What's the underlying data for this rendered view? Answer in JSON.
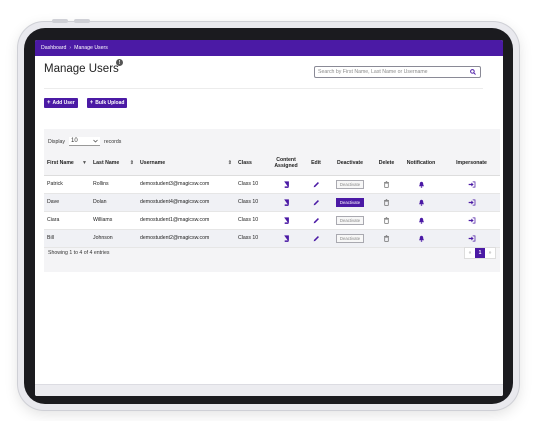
{
  "breadcrumb": {
    "home": "Dashboard",
    "separator": "›",
    "current": "Manage Users"
  },
  "page": {
    "title": "Manage Users",
    "info_badge": "!"
  },
  "search": {
    "placeholder": "Search by First Name, Last Name or Username",
    "value": ""
  },
  "actions": {
    "add_user": "Add User",
    "bulk_upload": "Bulk Upload"
  },
  "table_controls": {
    "display_label": "Display",
    "page_size": "10",
    "records_label": "records"
  },
  "columns": [
    "First Name",
    "Last Name",
    "Username",
    "Class",
    "Content Assigned",
    "Edit",
    "Deactivate",
    "Delete",
    "Notification",
    "Impersonate"
  ],
  "rows": [
    {
      "first": "Patrick",
      "last": "Rollins",
      "username": "demostudent3@magicsw.com",
      "class": "Class 10",
      "deactivate": "Deactivate",
      "deactivate_active": false
    },
    {
      "first": "Dave",
      "last": "Dolan",
      "username": "demostudent4@magicsw.com",
      "class": "Class 10",
      "deactivate": "Deactivate",
      "deactivate_active": true
    },
    {
      "first": "Ciara",
      "last": "Williams",
      "username": "demostudent1@magicsw.com",
      "class": "Class 10",
      "deactivate": "Deactivate",
      "deactivate_active": false
    },
    {
      "first": "Bill",
      "last": "Johnson",
      "username": "demostudent2@magicsw.com",
      "class": "Class 10",
      "deactivate": "Deactivate",
      "deactivate_active": false
    }
  ],
  "footer": {
    "entries_text": "Showing 1 to 4 of 4 entries"
  },
  "pagination": {
    "prev": "«",
    "current": "1",
    "next": "»"
  },
  "colors": {
    "brand": "#4b1aa5"
  }
}
